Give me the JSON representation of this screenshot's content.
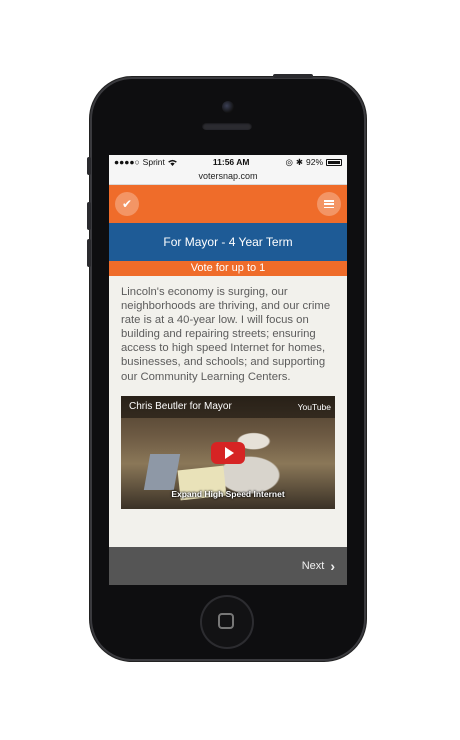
{
  "status": {
    "signal": "●●●●○",
    "carrier": "Sprint",
    "wifi_icon": "wifi-icon",
    "time": "11:56 AM",
    "battery_percent": "92%",
    "battery_level": 0.92
  },
  "browser": {
    "url": "votersnap.com"
  },
  "appbar": {
    "left_icon": "checkmark-icon",
    "right_icon": "menu-icon",
    "accent_color": "#ef6c2a"
  },
  "race": {
    "title": "For Mayor - 4 Year Term",
    "instruction": "Vote for up to 1",
    "title_bg": "#1e5b96"
  },
  "description": "Lincoln's economy is surging, our neighborhoods are thriving, and our crime rate is at a 40-year low. I will focus on building and repairing streets; ensuring access to high speed Internet for homes, businesses, and schools; and supporting our Community Learning Centers.",
  "video": {
    "title": "Chris Beutler for Mayor",
    "provider": "YouTube",
    "caption": "Expand High Speed Internet"
  },
  "footer": {
    "next_label": "Next",
    "next_icon": "chevron-right-icon"
  }
}
